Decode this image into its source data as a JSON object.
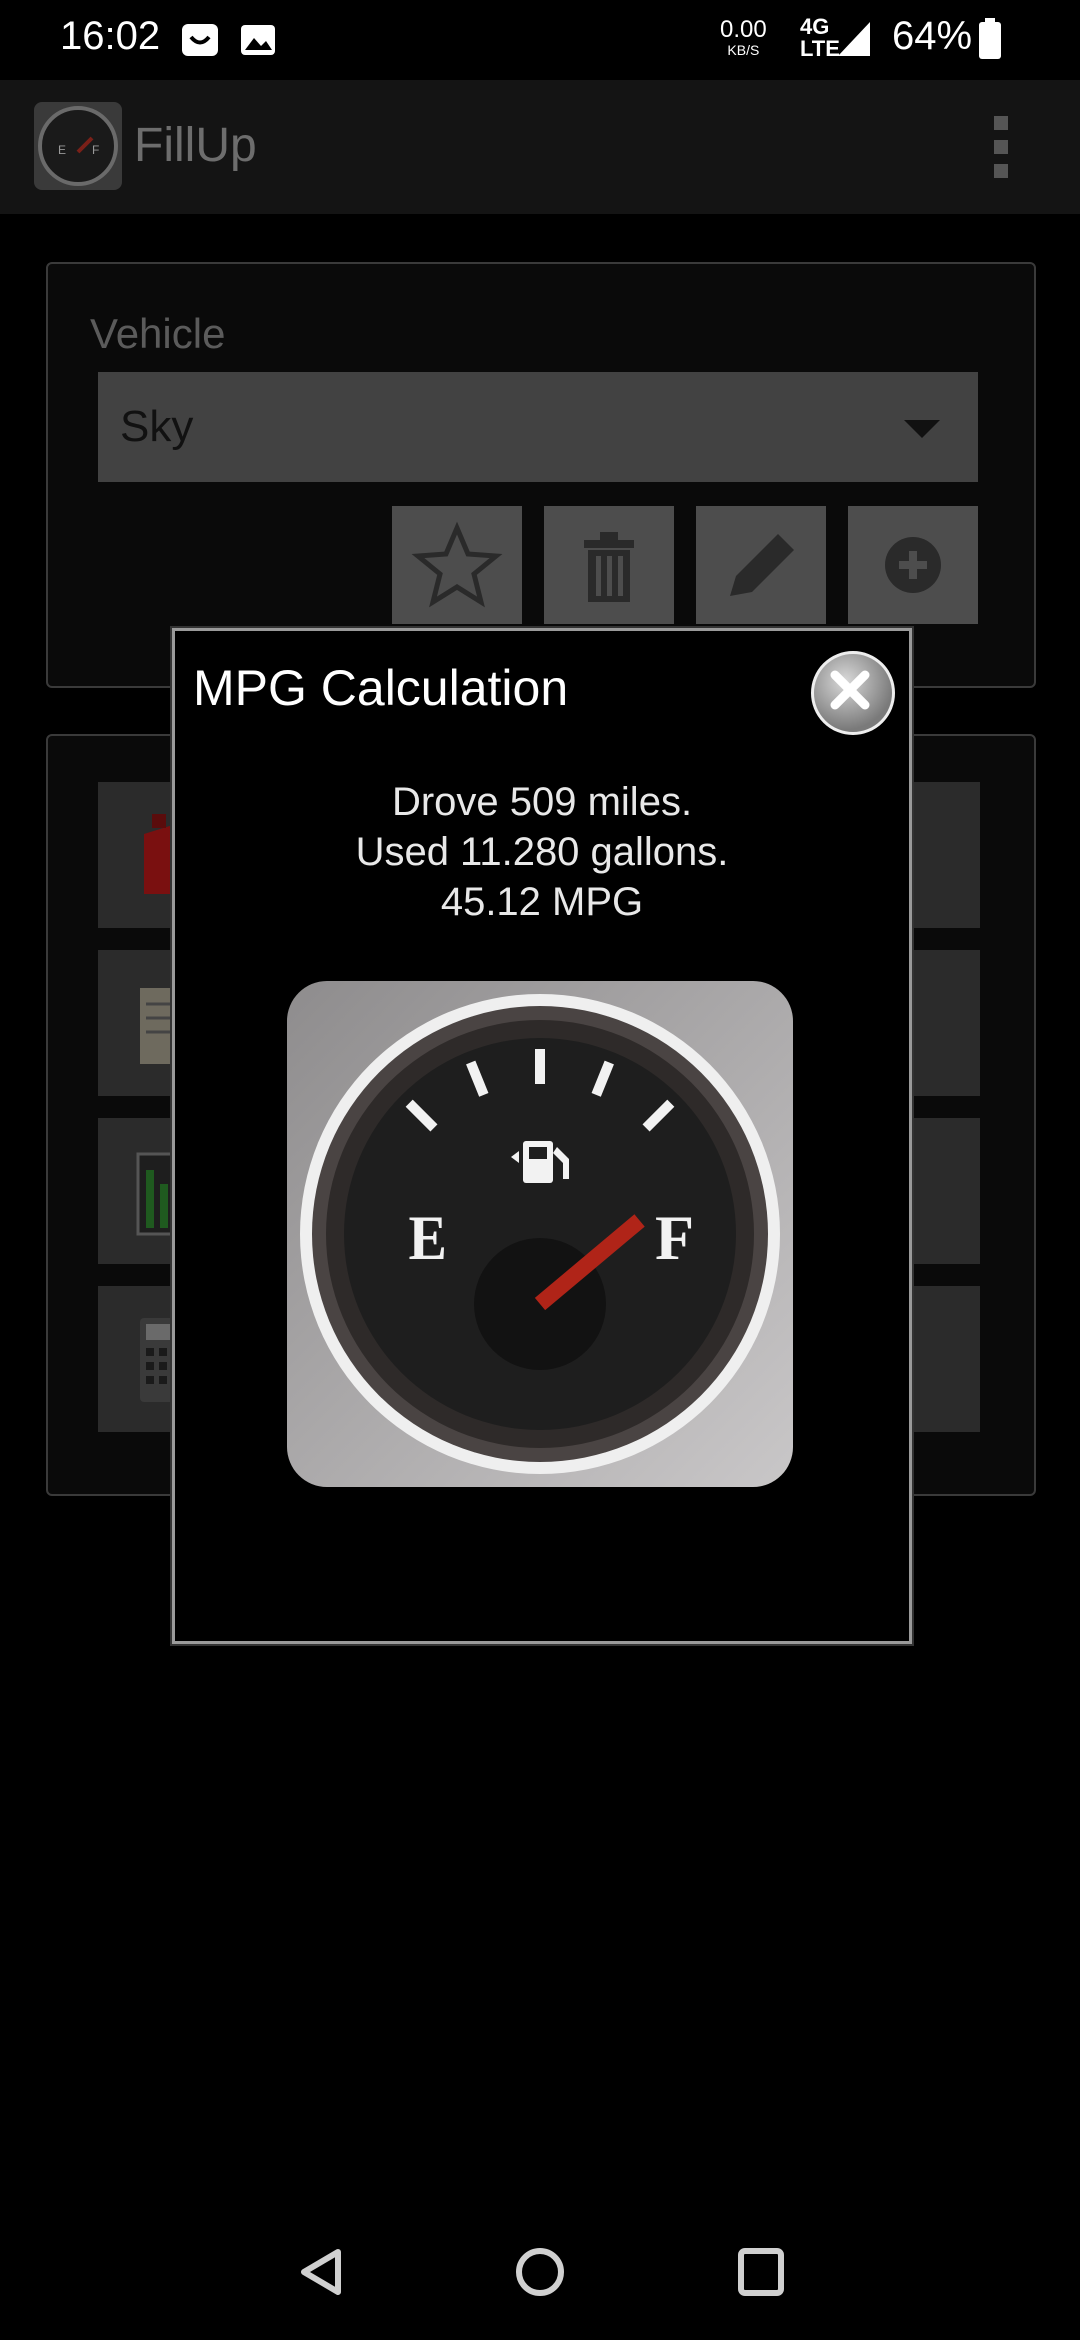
{
  "status_bar": {
    "time": "16:02",
    "net_speed": "0.00",
    "net_unit": "KB/S",
    "network_top": "4G",
    "network_bottom": "LTE",
    "battery": "64%",
    "icons": [
      "notification-smile-icon",
      "notification-image-icon",
      "signal-icon",
      "battery-icon"
    ]
  },
  "app_bar": {
    "title": "FillUp",
    "logo_icon": "fuel-gauge-logo-icon",
    "menu_icon": "overflow-menu-icon"
  },
  "vehicle_panel": {
    "label": "Vehicle",
    "selected_vehicle": "Sky",
    "buttons": [
      "star-icon",
      "trash-icon",
      "edit-pencil-icon",
      "add-circle-icon"
    ]
  },
  "menu_tiles": [
    "fuel-can-icon",
    "notepad-icon",
    "chart-icon",
    "calculator-icon"
  ],
  "dialog": {
    "title": "MPG Calculation",
    "close_icon": "close-icon",
    "line1": "Drove 509 miles.",
    "line2": "Used 11.280 gallons.",
    "line3": "45.12 MPG",
    "gauge_empty_label": "E",
    "gauge_full_label": "F",
    "gauge_level": 1.0
  },
  "nav_bar": {
    "icons": [
      "back-icon",
      "home-icon",
      "recents-icon"
    ]
  },
  "colors": {
    "needle": "#b02418",
    "dialog_border": "#9a9a9a"
  }
}
